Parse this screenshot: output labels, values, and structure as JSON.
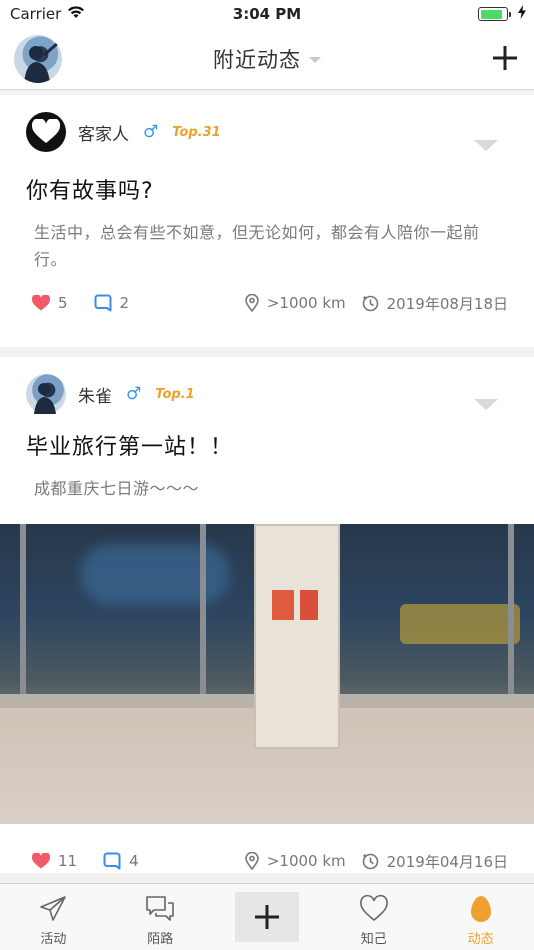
{
  "status_bar": {
    "carrier": "Carrier",
    "time": "3:04 PM"
  },
  "nav": {
    "title": "附近动态",
    "add_icon": "plus-icon"
  },
  "posts": [
    {
      "username": "客家人",
      "gender_symbol": "♂",
      "rank": "Top.31",
      "title": "你有故事吗?",
      "body": "生活中，总会有些不如意，但无论如何，都会有人陪你一起前行。",
      "likes": "5",
      "comments": "2",
      "distance": ">1000 km",
      "date": "2019年08月18日"
    },
    {
      "username": "朱雀",
      "gender_symbol": "♂",
      "rank": "Top.1",
      "title": "毕业旅行第一站！！",
      "body": "成都重庆七日游～～～",
      "likes": "11",
      "comments": "4",
      "distance": ">1000 km",
      "date": "2019年04月16日"
    }
  ],
  "tabs": [
    {
      "label": "活动",
      "icon": "paper-plane-icon"
    },
    {
      "label": "陌路",
      "icon": "chat-bubbles-icon"
    },
    {
      "label": "",
      "icon": "plus-icon"
    },
    {
      "label": "知己",
      "icon": "heart-icon"
    },
    {
      "label": "动态",
      "icon": "egg-icon"
    }
  ],
  "colors": {
    "accent": "#f0a030",
    "like": "#f25a6a",
    "comment": "#3a8ee6",
    "male": "#3a9ae8"
  }
}
